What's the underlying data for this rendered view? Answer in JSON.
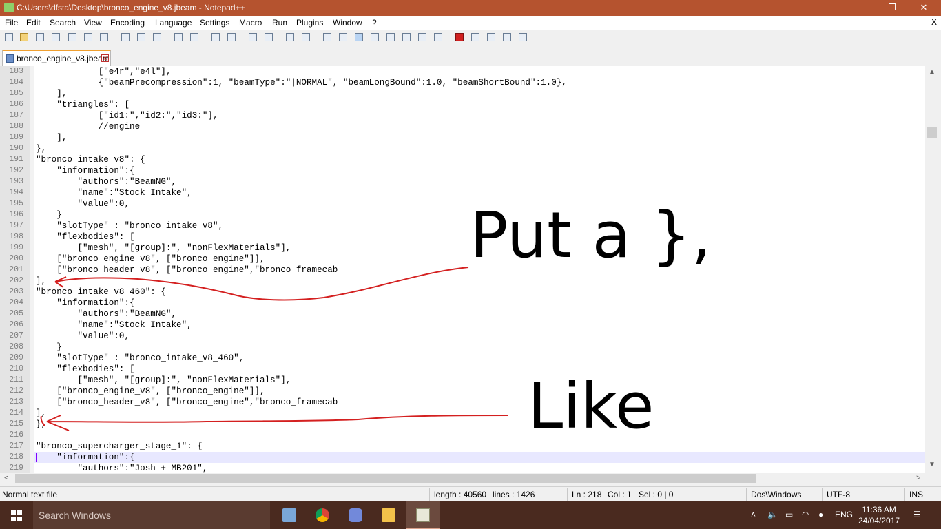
{
  "window": {
    "title": "C:\\Users\\dfsta\\Desktop\\bronco_engine_v8.jbeam - Notepad++",
    "min_glyph": "—",
    "max_glyph": "❐",
    "close_glyph": "✕"
  },
  "menu": {
    "items": [
      "File",
      "Edit",
      "Search",
      "View",
      "Encoding",
      "Language",
      "Settings",
      "Macro",
      "Run",
      "Plugins",
      "Window",
      "?"
    ],
    "close_glyph": "X"
  },
  "toolbar": {
    "icons": [
      "new-file-icon",
      "open-file-icon",
      "save-icon",
      "save-all-icon",
      "close-icon",
      "close-all-icon",
      "print-icon",
      "cut-icon",
      "copy-icon",
      "paste-icon",
      "undo-icon",
      "redo-icon",
      "find-icon",
      "replace-icon",
      "zoom-in-icon",
      "zoom-out-icon",
      "sync-vertical-icon",
      "sync-horizontal-icon",
      "word-wrap-icon",
      "show-all-chars-icon",
      "indent-guide-icon",
      "doc-map-icon",
      "function-list-icon",
      "folder-workspace-icon",
      "monitor-icon",
      "record-macro-icon",
      "stop-macro-icon",
      "play-macro-icon",
      "run-macro-multiple-icon",
      "save-macro-icon"
    ]
  },
  "tab": {
    "label": "bronco_engine_v8.jbeam",
    "close_glyph": "✕"
  },
  "editor": {
    "lines": [
      {
        "n": "183",
        "t": "            [\"e4r\",\"e4l\"],"
      },
      {
        "n": "184",
        "t": "            {\"beamPrecompression\":1, \"beamType\":\"|NORMAL\", \"beamLongBound\":1.0, \"beamShortBound\":1.0},"
      },
      {
        "n": "185",
        "t": "    ],"
      },
      {
        "n": "186",
        "t": "    \"triangles\": ["
      },
      {
        "n": "187",
        "t": "            [\"id1:\",\"id2:\",\"id3:\"],"
      },
      {
        "n": "188",
        "t": "            //engine"
      },
      {
        "n": "189",
        "t": "    ],"
      },
      {
        "n": "190",
        "t": "},"
      },
      {
        "n": "191",
        "t": "\"bronco_intake_v8\": {"
      },
      {
        "n": "192",
        "t": "    \"information\":{"
      },
      {
        "n": "193",
        "t": "        \"authors\":\"BeamNG\","
      },
      {
        "n": "194",
        "t": "        \"name\":\"Stock Intake\","
      },
      {
        "n": "195",
        "t": "        \"value\":0,"
      },
      {
        "n": "196",
        "t": "    }"
      },
      {
        "n": "197",
        "t": "    \"slotType\" : \"bronco_intake_v8\","
      },
      {
        "n": "198",
        "t": "    \"flexbodies\": ["
      },
      {
        "n": "199",
        "t": "        [\"mesh\", \"[group]:\", \"nonFlexMaterials\"],"
      },
      {
        "n": "200",
        "t": "    [\"bronco_engine_v8\", [\"bronco_engine\"]],"
      },
      {
        "n": "201",
        "t": "    [\"bronco_header_v8\", [\"bronco_engine\",\"bronco_framecab"
      },
      {
        "n": "202",
        "t": "],"
      },
      {
        "n": "203",
        "t": "\"bronco_intake_v8_460\": {"
      },
      {
        "n": "204",
        "t": "    \"information\":{"
      },
      {
        "n": "205",
        "t": "        \"authors\":\"BeamNG\","
      },
      {
        "n": "206",
        "t": "        \"name\":\"Stock Intake\","
      },
      {
        "n": "207",
        "t": "        \"value\":0,"
      },
      {
        "n": "208",
        "t": "    }"
      },
      {
        "n": "209",
        "t": "    \"slotType\" : \"bronco_intake_v8_460\","
      },
      {
        "n": "210",
        "t": "    \"flexbodies\": ["
      },
      {
        "n": "211",
        "t": "        [\"mesh\", \"[group]:\", \"nonFlexMaterials\"],"
      },
      {
        "n": "212",
        "t": "    [\"bronco_engine_v8\", [\"bronco_engine\"]],"
      },
      {
        "n": "213",
        "t": "    [\"bronco_header_v8\", [\"bronco_engine\",\"bronco_framecab"
      },
      {
        "n": "214",
        "t": "],"
      },
      {
        "n": "215",
        "t": "},"
      },
      {
        "n": "216",
        "t": ""
      },
      {
        "n": "217",
        "t": "\"bronco_supercharger_stage_1\": {"
      },
      {
        "n": "218",
        "t": "    \"information\":{"
      },
      {
        "n": "219",
        "t": "        \"authors\":\"Josh + MB201\","
      }
    ]
  },
  "status": {
    "file_type": "Normal text file",
    "length": "length : 40560",
    "lines": "lines : 1426",
    "ln": "Ln : 218",
    "col": "Col : 1",
    "sel": "Sel : 0 | 0",
    "eol": "Dos\\Windows",
    "encoding": "UTF-8",
    "mode": "INS"
  },
  "taskbar": {
    "search_placeholder": "Search Windows",
    "apps": [
      "computer-icon",
      "chrome-icon",
      "discord-icon",
      "file-explorer-icon",
      "notepad-plus-plus-icon"
    ],
    "language": "ENG",
    "time": "11:36 AM",
    "date": "24/04/2017"
  },
  "annotations": {
    "note1": "Put a },",
    "note2": "Like",
    "ink_color": "#d42020"
  }
}
